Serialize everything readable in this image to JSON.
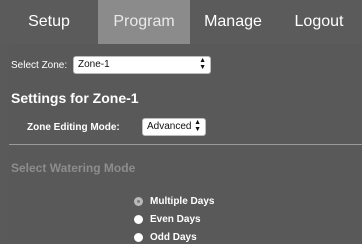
{
  "nav": {
    "items": [
      {
        "label": "Setup"
      },
      {
        "label": "Program",
        "active": true
      },
      {
        "label": "Manage"
      },
      {
        "label": "Logout"
      }
    ]
  },
  "zone": {
    "label": "Select Zone:",
    "selected": "Zone-1"
  },
  "settings": {
    "heading": "Settings for Zone-1",
    "mode_label": "Zone Editing Mode:",
    "mode_selected": "Advanced"
  },
  "watering": {
    "title": "Select Watering Mode",
    "options": [
      {
        "label": "Multiple Days",
        "selected": true
      },
      {
        "label": "Even Days"
      },
      {
        "label": "Odd Days"
      }
    ]
  }
}
